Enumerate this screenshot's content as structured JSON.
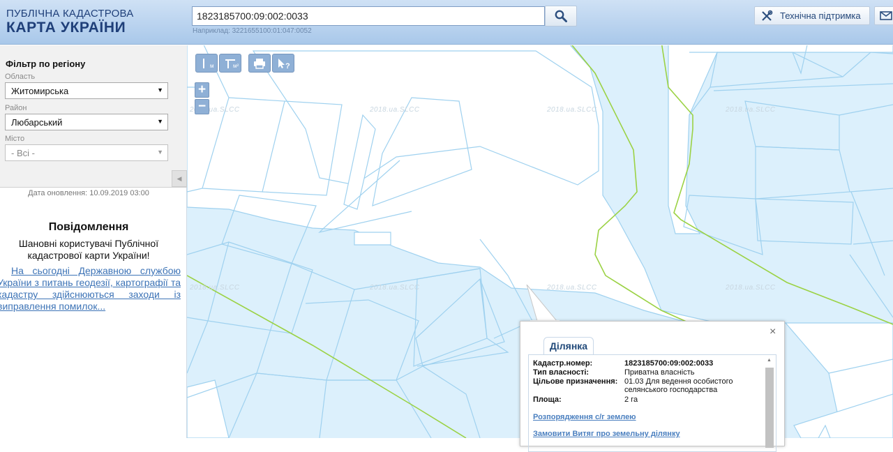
{
  "header": {
    "logo_line1": "ПУБЛІЧНА КАДАСТРОВА",
    "logo_line2": "КАРТА УКРАЇНИ",
    "search_value": "1823185700:09:002:0033",
    "search_hint": "Наприклад: 3221655100:01:047:0052",
    "support_label": "Технічна підтримка",
    "icons": {
      "search": "search-icon",
      "support": "tools-icon",
      "mail": "mail-icon"
    }
  },
  "sidebar": {
    "filter_title": "Фільтр по регіону",
    "oblast_label": "Область",
    "oblast_value": "Житомирська",
    "rayon_label": "Район",
    "rayon_value": "Любарський",
    "city_label": "Місто",
    "city_value": "- Всі -",
    "update_date": "Дата оновлення: 10.09.2019 03:00",
    "notice_title": "Повідомлення",
    "notice_greeting": "Шановні користувачі Публічної кадастрової карти України!",
    "notice_link": "На сьогодні Державною службою України з питань геодезії, картографії та кадастру здійснюються заходи із виправлення помилок..."
  },
  "map": {
    "watermark": "2018.ua.SLCC",
    "tools": {
      "ruler_label": "м",
      "area_label": "м²",
      "print": "printer-icon",
      "identify": "cursor-help-icon"
    },
    "zoom_in_label": "+",
    "zoom_out_label": "−",
    "colors": {
      "parcel_fill": "#dcf0fc",
      "parcel_stroke": "#9fd1ef",
      "boundary": "#9bd244"
    }
  },
  "popup": {
    "tab_label": "Ділянка",
    "close_label": "×",
    "rows": [
      {
        "key": "Кадастр.номер:",
        "value": "1823185700:09:002:0033"
      },
      {
        "key": "Тип власності:",
        "value": "Приватна власність"
      },
      {
        "key": "Цільове призначення:",
        "value": "01.03 Для ведення особистого селянського господарства"
      },
      {
        "key": "Площа:",
        "value": "2 га"
      }
    ],
    "link1": "Розпорядження с/г землею",
    "link2": "Замовити Витяг про земельну ділянку"
  }
}
